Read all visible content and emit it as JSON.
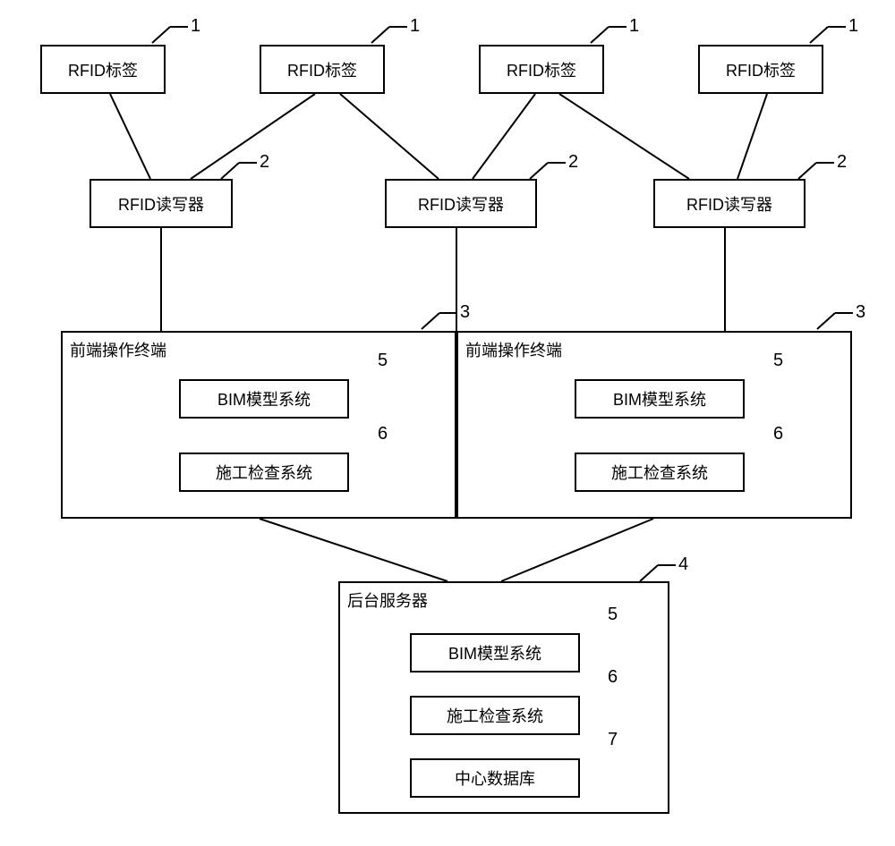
{
  "labels": {
    "rfid_tag": "RFID标签",
    "rfid_reader": "RFID读写器",
    "frontend_terminal": "前端操作终端",
    "bim_system": "BIM模型系统",
    "construction_inspect": "施工检查系统",
    "backend_server": "后台服务器",
    "central_db": "中心数据库"
  },
  "numbers": {
    "n1": "1",
    "n2": "2",
    "n3": "3",
    "n4": "4",
    "n5": "5",
    "n6": "6",
    "n7": "7"
  }
}
